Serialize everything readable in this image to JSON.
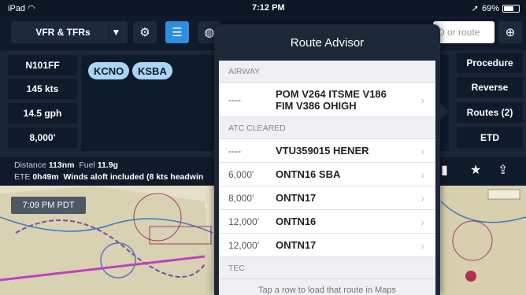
{
  "status": {
    "device": "iPad",
    "time": "7:12 PM",
    "battery": "69%",
    "battery_level": 0.69
  },
  "toolbar": {
    "map_layer": "VFR & TFRs",
    "search_placeholder": "D or route"
  },
  "flight": {
    "tail": "N101FF",
    "speed": "145 kts",
    "fuel_flow": "14.5 gph",
    "altitude": "8,000'",
    "departure": "KCNO",
    "destination": "KSBA"
  },
  "actions": [
    "Procedure",
    "Reverse",
    "Routes (2)",
    "ETD"
  ],
  "summary": {
    "distance_label": "Distance",
    "distance": "113nm",
    "fuel_label": "Fuel",
    "fuel": "11.9g",
    "ete_label": "ETE",
    "ete": "0h49m",
    "winds": "Winds aloft included (8 kts headwin"
  },
  "map": {
    "clock": "7:09 PM PDT"
  },
  "route_advisor": {
    "title": "Route Advisor",
    "sections": [
      {
        "header": "AIRWAY",
        "rows": [
          {
            "alt": "----",
            "route_line1": "POM V264 ITSME V186",
            "route_line2": "FIM V386 OHIGH"
          }
        ]
      },
      {
        "header": "ATC CLEARED",
        "rows": [
          {
            "alt": "----",
            "route": "VTU359015 HENER"
          },
          {
            "alt": "6,000'",
            "route": "ONTN16 SBA"
          },
          {
            "alt": "8,000'",
            "route": "ONTN17"
          },
          {
            "alt": "12,000'",
            "route": "ONTN16"
          },
          {
            "alt": "12,000'",
            "route": "ONTN17"
          }
        ]
      },
      {
        "header": "TEC",
        "rows": []
      }
    ],
    "footer": "Tap a row to load that route in Maps"
  },
  "colors": {
    "accent": "#2e8ee0",
    "panel": "#0f1a2a",
    "pill": "#a9d6f5"
  }
}
